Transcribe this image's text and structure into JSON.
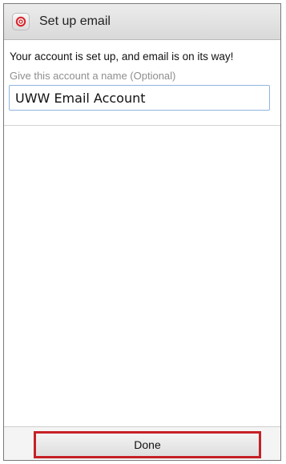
{
  "header": {
    "title": "Set up email",
    "icon": "email-app-icon",
    "icon_color": "#d7262e"
  },
  "main": {
    "message": "Your account is set up, and email is on its way!",
    "account_name": {
      "label": "Give this account a name (Optional)",
      "value": "UWW Email Account"
    }
  },
  "footer": {
    "done_label": "Done",
    "highlight_color": "#c62026"
  }
}
